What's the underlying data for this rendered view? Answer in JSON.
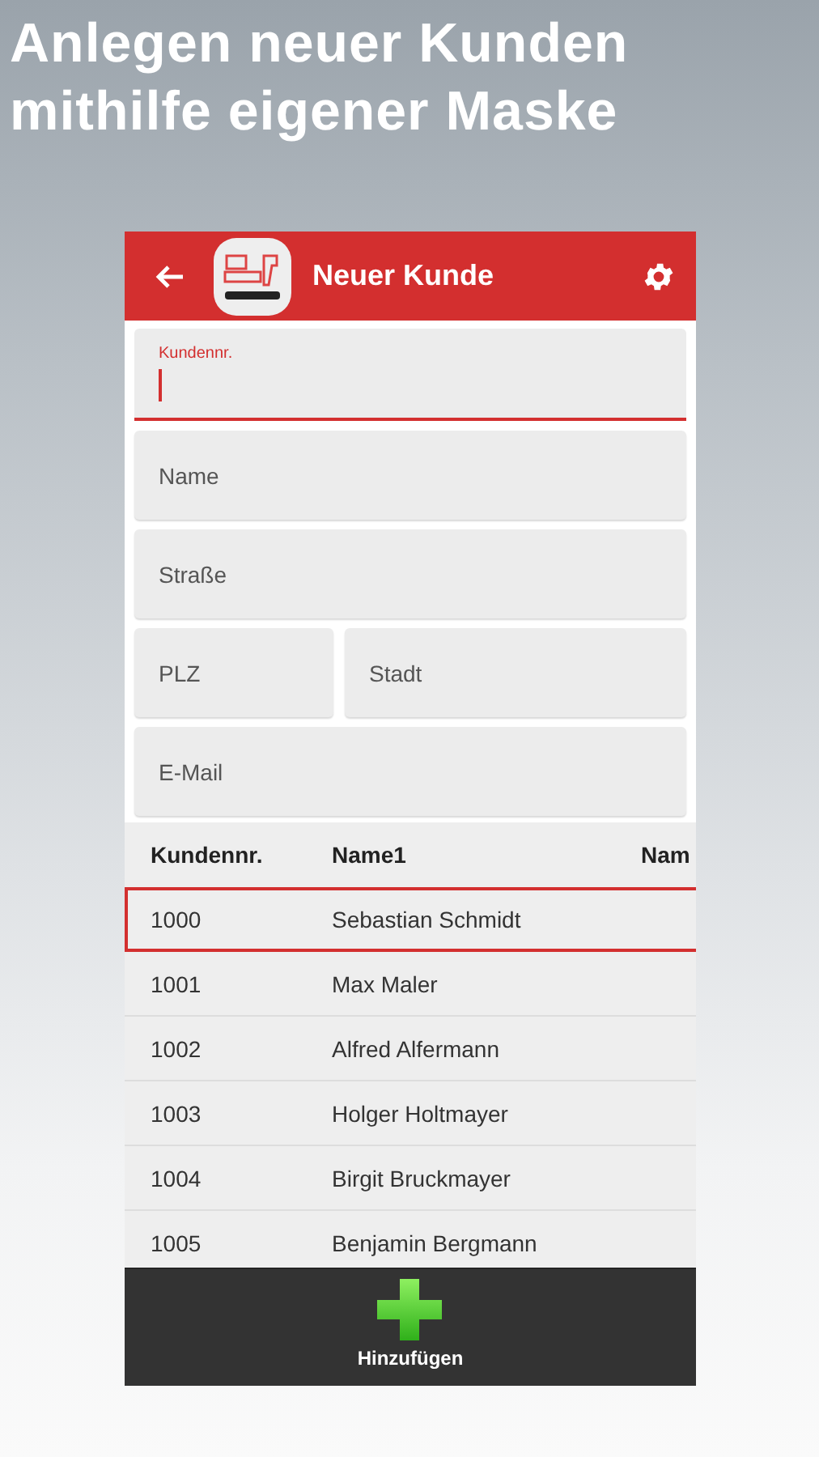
{
  "headline": [
    "Anlegen neuer Kunden",
    "mithilfe eigener Maske"
  ],
  "app_bar": {
    "title": "Neuer Kunde"
  },
  "form": [
    [
      {
        "label": "Kundennr.",
        "focused": true
      }
    ],
    [
      {
        "label": "Name",
        "focused": false
      }
    ],
    [
      {
        "label": "Straße",
        "focused": false
      }
    ],
    [
      {
        "label": "PLZ",
        "focused": false
      },
      {
        "label": "Stadt",
        "focused": false
      }
    ],
    [
      {
        "label": "E-Mail",
        "focused": false
      }
    ]
  ],
  "table": {
    "columns": [
      "Kundennr.",
      "Name1",
      "Nam"
    ],
    "rows": [
      {
        "cells": [
          "1000",
          "Sebastian Schmidt"
        ],
        "selected": true
      },
      {
        "cells": [
          "1001",
          "Max Maler"
        ],
        "selected": false
      },
      {
        "cells": [
          "1002",
          "Alfred Alfermann"
        ],
        "selected": false
      },
      {
        "cells": [
          "1003",
          "Holger Holtmayer"
        ],
        "selected": false
      },
      {
        "cells": [
          "1004",
          "Birgit Bruckmayer"
        ],
        "selected": false
      },
      {
        "cells": [
          "1005",
          "Benjamin Bergmann"
        ],
        "selected": false
      }
    ]
  },
  "bottom_bar": {
    "button": "Hinzufügen"
  }
}
